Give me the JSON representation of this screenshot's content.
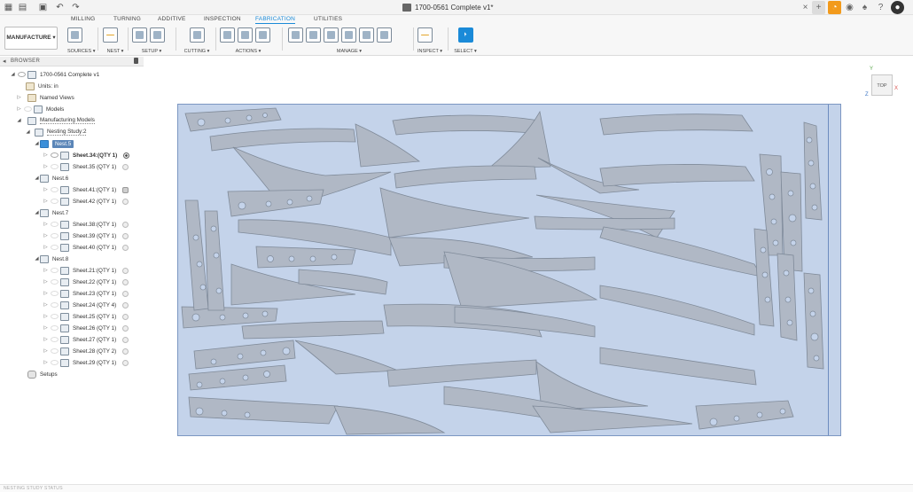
{
  "titlebar": {
    "document_title": "1700-0561 Complete v1*",
    "icons": [
      "grid-icon",
      "file-icon",
      "save-icon",
      "undo-icon",
      "redo-icon",
      "close-tab-icon",
      "add-tab-icon",
      "extension-icon",
      "online-icon",
      "notification-icon",
      "help-icon",
      "profile-icon"
    ]
  },
  "ribbon": {
    "workspace_label": "MANUFACTURE",
    "tabs": [
      {
        "label": "MILLING"
      },
      {
        "label": "TURNING"
      },
      {
        "label": "ADDITIVE"
      },
      {
        "label": "INSPECTION"
      },
      {
        "label": "FABRICATION"
      },
      {
        "label": "UTILITIES"
      }
    ],
    "active_tab": "FABRICATION",
    "groups": [
      {
        "label": "SOURCES ▾"
      },
      {
        "label": "NEST ▾"
      },
      {
        "label": "SETUP ▾"
      },
      {
        "label": "CUTTING ▾"
      },
      {
        "label": "ACTIONS ▾"
      },
      {
        "label": "MANAGE ▾"
      },
      {
        "label": "INSPECT ▾"
      },
      {
        "label": "SELECT ▾"
      }
    ],
    "accent_color": "#1a8ad8"
  },
  "browser": {
    "title": "BROWSER",
    "items": [
      {
        "label": "1700-0561 Complete v1"
      },
      {
        "label": "Units: in"
      },
      {
        "label": "Named Views"
      },
      {
        "label": "Models"
      },
      {
        "label": "Manufacturing Models"
      },
      {
        "label": "Nesting Study:2"
      },
      {
        "label": "Nest.5"
      },
      {
        "label": "Sheet.34:(QTY 1)"
      },
      {
        "label": "Sheet.35 (QTY 1)"
      },
      {
        "label": "Nest.6"
      },
      {
        "label": "Sheet.41:(QTY 1)"
      },
      {
        "label": "Sheet.42 (QTY 1)"
      },
      {
        "label": "Nest.7"
      },
      {
        "label": "Sheet.38:(QTY 1)"
      },
      {
        "label": "Sheet.39 (QTY 1)"
      },
      {
        "label": "Sheet.40 (QTY 1)"
      },
      {
        "label": "Nest.8"
      },
      {
        "label": "Sheet.21:(QTY 1)"
      },
      {
        "label": "Sheet.22 (QTY 1)"
      },
      {
        "label": "Sheet.23 (QTY 1)"
      },
      {
        "label": "Sheet.24 (QTY 4)"
      },
      {
        "label": "Sheet.25 (QTY 1)"
      },
      {
        "label": "Sheet.26 (QTY 1)"
      },
      {
        "label": "Sheet.27 (QTY 1)"
      },
      {
        "label": "Sheet.28 (QTY 2)"
      },
      {
        "label": "Sheet.29 (QTY 1)"
      },
      {
        "label": "Setups"
      }
    ]
  },
  "viewport": {
    "view_label": "TOP",
    "axis_x": "X",
    "axis_y": "Y",
    "axis_z": "Z",
    "sheet_color": "#c4d3ea",
    "part_color": "#b0b8c5"
  },
  "bottombar": {
    "label": "NESTING STUDY STATUS"
  }
}
